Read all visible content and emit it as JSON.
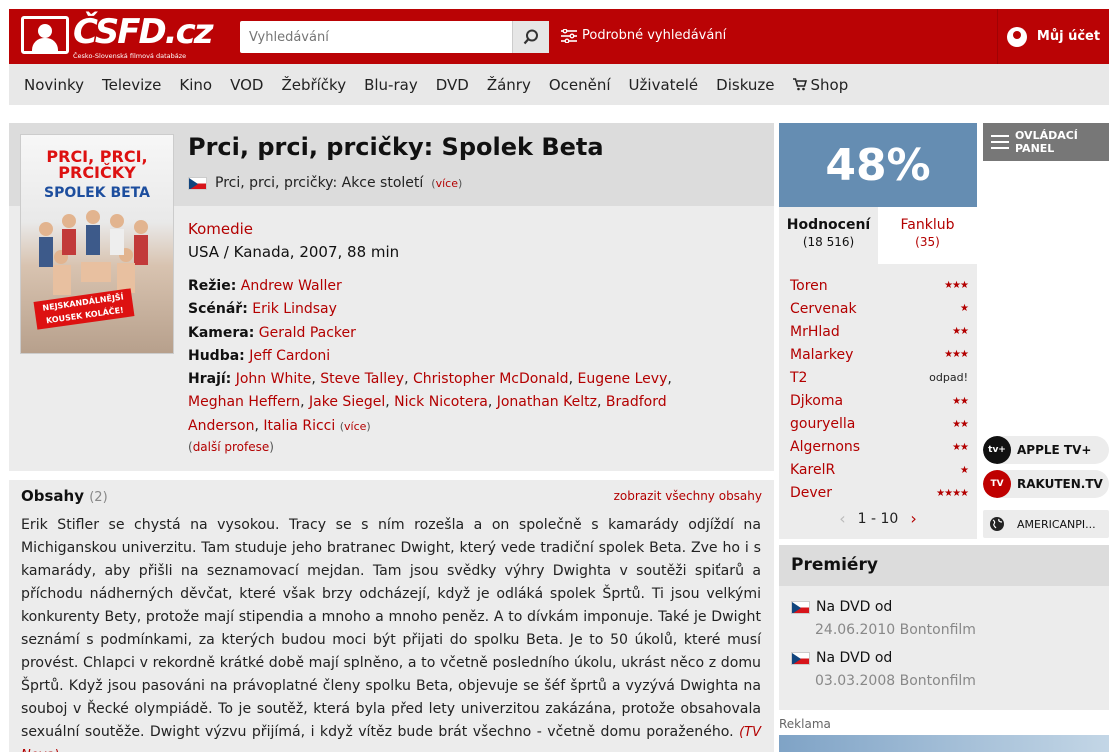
{
  "header": {
    "logo_text": "ČSFD.cz",
    "logo_sub": "Česko-Slovenská filmová databáze",
    "search_placeholder": "Vyhledávání",
    "advanced_search": "Podrobné vyhledávání",
    "account": "Můj účet",
    "brand_color": "#ba0305"
  },
  "nav": [
    "Novinky",
    "Televize",
    "Kino",
    "VOD",
    "Žebříčky",
    "Blu-ray",
    "DVD",
    "Žánry",
    "Ocenění",
    "Uživatelé",
    "Diskuze",
    "Shop"
  ],
  "film": {
    "poster_title": "PRCI, PRCI, PRCIČKY",
    "poster_subtitle": "SPOLEK BETA",
    "poster_badge": "NEJSKANDÁLNĚJŠÍ KOUSEK KOLÁČE!",
    "title": "Prci, prci, prcičky: Spolek Beta",
    "orig_title": "Prci, prci, prcičky: Akce století",
    "more": "více",
    "genre": "Komedie",
    "origin": "USA / Kanada, 2007, 88 min",
    "directing_label": "Režie:",
    "director": "Andrew Waller",
    "writing_label": "Scénář:",
    "writer": "Erik Lindsay",
    "camera_label": "Kamera:",
    "camera": "Gerald Packer",
    "music_label": "Hudba:",
    "music": "Jeff Cardoni",
    "cast_label": "Hrají:",
    "cast": [
      "John White",
      "Steve Talley",
      "Christopher McDonald",
      "Eugene Levy",
      "Meghan Heffern",
      "Jake Siegel",
      "Nick Nicotera",
      "Jonathan Keltz",
      "Bradford Anderson",
      "Italia Ricci"
    ],
    "more_professions": "další profese"
  },
  "plot": {
    "heading": "Obsahy",
    "count": "(2)",
    "show_all": "zobrazit všechny obsahy",
    "text": "Erik Stifler se chystá na vysokou. Tracy se s ním rozešla a on společně s kamarády odjíždí na Michiganskou univerzitu. Tam studuje jeho bratranec Dwight, který vede tradiční spolek Beta. Zve ho i s kamarády, aby přišli na seznamovací mejdan. Tam jsou svědky výhry Dwighta v soutěži spiťarů a příchodu nádherných děvčat, které však brzy odcházejí, když je odláká spolek Šprtů. Ti jsou velkými konkurenty Bety, protože mají stipendia a mnoho a mnoho peněz. A to dívkám imponuje. Také je Dwight seznámí s podmínkami, za kterých budou moci být přijati do spolku Beta. Je to 50 úkolů, které musí provést. Chlapci v rekordně krátké době mají splněno, a to včetně posledního úkolu, ukrást něco z domu Šprtů. Když jsou pasováni na právoplatné členy spolku Beta, objevuje se šéf šprtů a vyzývá Dwighta na souboj v Řecké olympiádě. To je soutěž, která byla před lety univerzitou zakázána, protože obsahovala sexuální soutěže. Dwight výzvu přijímá, i když vítěz bude brát všechno - včetně domu poraženého.",
    "source": "(TV Nova)"
  },
  "rating": {
    "score": "48%",
    "score_color": "#658db2",
    "tab_ratings": "Hodnocení",
    "tab_ratings_count": "(18 516)",
    "tab_fanclub": "Fanklub",
    "tab_fanclub_count": "(35)",
    "raters": [
      {
        "name": "Toren",
        "stars": 3,
        "label": ""
      },
      {
        "name": "Cervenak",
        "stars": 1,
        "label": ""
      },
      {
        "name": "MrHlad",
        "stars": 2,
        "label": ""
      },
      {
        "name": "Malarkey",
        "stars": 3,
        "label": ""
      },
      {
        "name": "T2",
        "stars": 0,
        "label": "odpad!"
      },
      {
        "name": "Djkoma",
        "stars": 2,
        "label": ""
      },
      {
        "name": "gouryella",
        "stars": 2,
        "label": ""
      },
      {
        "name": "Algernons",
        "stars": 2,
        "label": ""
      },
      {
        "name": "KarelR",
        "stars": 1,
        "label": ""
      },
      {
        "name": "Dever",
        "stars": 4,
        "label": ""
      }
    ],
    "pager": "1 - 10"
  },
  "control_panel": "OVLÁDACÍ PANEL",
  "vod": {
    "apple": "APPLE TV+",
    "apple_icon": "tv+",
    "rakuten": "RAKUTEN.TV",
    "rakuten_icon": "TV",
    "american": "AMERICANPI..."
  },
  "premieres": {
    "heading": "Premiéry",
    "items": [
      {
        "label": "Na DVD od",
        "detail": "24.06.2010 Bontonfilm"
      },
      {
        "label": "Na DVD od",
        "detail": "03.03.2008 Bontonfilm"
      }
    ]
  },
  "ad_label": "Reklama"
}
